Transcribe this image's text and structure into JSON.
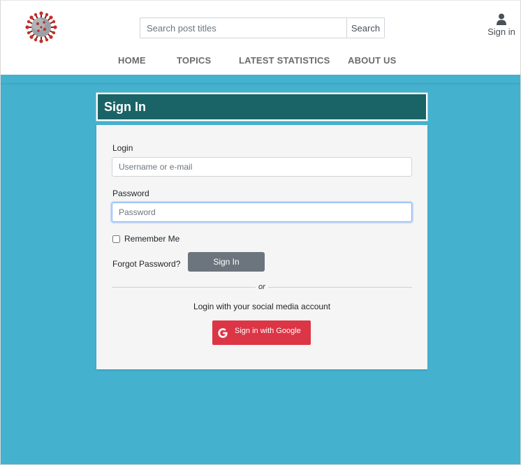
{
  "header": {
    "search": {
      "placeholder": "Search post titles",
      "button_label": "Search"
    },
    "signin_label": "Sign in",
    "nav": [
      {
        "label": "HOME"
      },
      {
        "label": "TOPICS"
      },
      {
        "label": "LATEST STATISTICS"
      },
      {
        "label": "ABOUT US"
      }
    ]
  },
  "signin_panel": {
    "title": "Sign In",
    "login_label": "Login",
    "login_placeholder": "Username or e-mail",
    "password_label": "Password",
    "password_placeholder": "Password",
    "remember_label": "Remember Me",
    "forgot_label": "Forgot Password?",
    "submit_label": "Sign In",
    "or_label": "or",
    "social_text": "Login with your social media account",
    "google_label": "Sign in with Google"
  },
  "colors": {
    "page_bg": "#44b1ce",
    "panel_header": "#1a6467",
    "google_button": "#dc3545",
    "signin_button": "#6c757d"
  },
  "icons": [
    "virus-logo-icon",
    "user-icon",
    "google-icon"
  ]
}
